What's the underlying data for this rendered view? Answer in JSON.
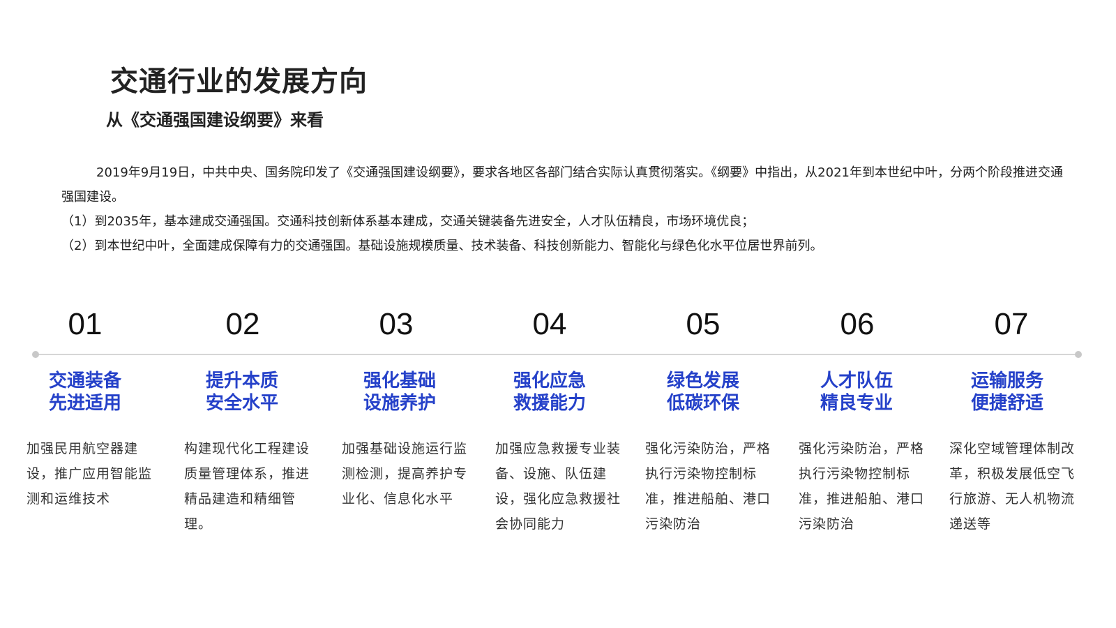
{
  "header": {
    "title": "交通行业的发展方向",
    "subtitle": "从《交通强国建设纲要》来看"
  },
  "intro": {
    "paragraph1": "2019年9月19日，中共中央、国务院印发了《交通强国建设纲要》，要求各地区各部门结合实际认真贯彻落实。《纲要》中指出，从2021年到本世纪中叶，分两个阶段推进交通强国建设。",
    "point1": "（1）到2035年，基本建成交通强国。交通科技创新体系基本建成，交通关键装备先进安全，人才队伍精良，市场环境优良；",
    "point2": "（2）到本世纪中叶，全面建成保障有力的交通强国。基础设施规模质量、技术装备、科技创新能力、智能化与绿色化水平位居世界前列。"
  },
  "colors": {
    "accent": "#2541c9",
    "timeline": "#d6d6d6"
  },
  "steps": [
    {
      "number": "01",
      "heading_line1": "交通装备",
      "heading_line2": "先进适用",
      "description": "加强民用航空器建设，推广应用智能监测和运维技术"
    },
    {
      "number": "02",
      "heading_line1": "提升本质",
      "heading_line2": "安全水平",
      "description": "构建现代化工程建设质量管理体系，推进精品建造和精细管理。"
    },
    {
      "number": "03",
      "heading_line1": "强化基础",
      "heading_line2": "设施养护",
      "description": "加强基础设施运行监测检测，提高养护专业化、信息化水平"
    },
    {
      "number": "04",
      "heading_line1": "强化应急",
      "heading_line2": "救援能力",
      "description": "加强应急救援专业装备、设施、队伍建设，强化应急救援社会协同能力"
    },
    {
      "number": "05",
      "heading_line1": "绿色发展",
      "heading_line2": "低碳环保",
      "description": "强化污染防治，严格执行污染物控制标准，推进船舶、港口污染防治"
    },
    {
      "number": "06",
      "heading_line1": "人才队伍",
      "heading_line2": "精良专业",
      "description": "强化污染防治，严格执行污染物控制标准，推进船舶、港口污染防治"
    },
    {
      "number": "07",
      "heading_line1": "运输服务",
      "heading_line2": "便捷舒适",
      "description": "深化空域管理体制改革，积极发展低空飞行旅游、无人机物流递送等"
    }
  ]
}
